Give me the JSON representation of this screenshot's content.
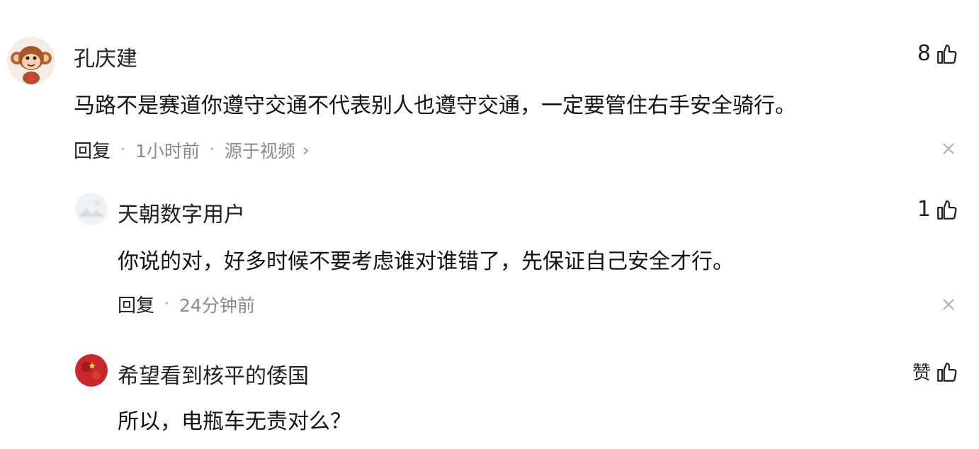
{
  "comments": [
    {
      "username": "孔庆建",
      "avatar": "monkey-avatar",
      "likes": "8",
      "text": "马路不是赛道你遵守交通不代表别人也遵守交通，一定要管住右手安全骑行。",
      "reply_label": "回复",
      "time": "1小时前",
      "source": "源于视频"
    },
    {
      "username": "天朝数字用户",
      "avatar": "default-avatar",
      "likes": "1",
      "text": "你说的对，好多时候不要考虑谁对谁错了，先保证自己安全才行。",
      "reply_label": "回复",
      "time": "24分钟前"
    },
    {
      "username": "希望看到核平的倭国",
      "avatar": "flag-avatar",
      "likes": "赞",
      "text": "所以，电瓶车无责对么？"
    }
  ],
  "icons": {
    "like": "thumbs-up-icon",
    "close": "close-icon",
    "chevron": "chevron-right-icon"
  },
  "colors": {
    "meta_text": "#8a8a8a",
    "primary_text": "#111111"
  }
}
